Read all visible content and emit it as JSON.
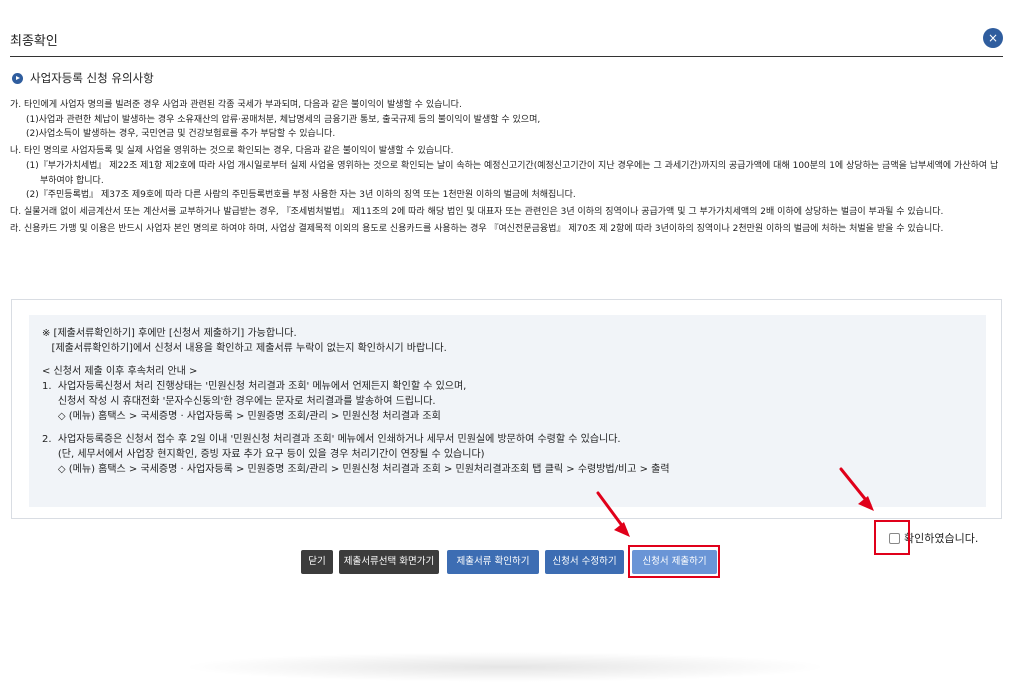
{
  "header": {
    "title": "최종확인",
    "close_label": "×"
  },
  "section": {
    "title": "사업자등록 신청 유의사항"
  },
  "notice": {
    "ga": "가. 타인에게 사업자 명의를 빌려준 경우 사업과 관련된 각종 국세가 부과되며, 다음과 같은 불이익이 발생할 수 있습니다.",
    "ga1": "(1)사업과 관련한 체납이 발생하는 경우 소유재산의 압류·공매처분, 체납명세의 금융기관 통보, 출국규제 등의 불이익이 발생할 수 있으며,",
    "ga2": "(2)사업소득이 발생하는 경우, 국민연금 및 건강보험료를 추가 부담할 수 있습니다.",
    "na": "나. 타인 명의로 사업자등록 및 실제 사업을 영위하는 것으로 확인되는 경우, 다음과 같은 불이익이 발생할 수 있습니다.",
    "na1": "(1)『부가가치세법』 제22조 제1항 제2호에 따라 사업 개시일로부터 실제 사업을 영위하는 것으로 확인되는 날이 속하는 예정신고기간(예정신고기간이 지난 경우에는 그 과세기간)까지의 공급가액에 대해 100분의 1에 상당하는 금액을 납부세액에 가산하여 납부하여야 합니다.",
    "na2": "(2)『주민등록법』 제37조 제9호에 따라 다른 사람의 주민등록번호를 부정 사용한 자는 3년 이하의 징역 또는 1천만원 이하의 벌금에 처해집니다.",
    "da": "다. 실물거래 없이 세금계산서 또는 계산서를 교부하거나 발급받는 경우, 『조세범처벌법』 제11조의 2에 따라 해당 법인 및 대표자 또는 관련인은 3년 이하의 징역이나 공급가액 및 그 부가가치세액의 2배 이하에 상당하는 벌금이 부과될 수 있습니다.",
    "ra": "라. 신용카드 가맹 및 이용은 반드시 사업자 본인 명의로 하여야 하며, 사업상 결제목적 이외의 용도로 신용카드를 사용하는 경우 『여신전문금융법』 제70조 제 2항에 따라 3년이하의 징역이나 2천만원 이하의 벌금에 처하는 처벌을 받을 수 있습니다."
  },
  "info": {
    "l1": "※ [제출서류확인하기] 후에만 [신청서 제출하기] 가능합니다.",
    "l2": "   [제출서류확인하기]에서 신청서 내용을 확인하고 제출서류 누락이 없는지 확인하시기 바랍니다.",
    "l3": "< 신청서 제출 이후 후속처리 안내 >",
    "l4": "1.  사업자등록신청서 처리 진행상태는 '민원신청 처리결과 조회' 메뉴에서 언제든지 확인할 수 있으며,",
    "l5": "     신청서 작성 시 휴대전화 '문자수신동의'한 경우에는 문자로 처리결과를 발송하여 드립니다.",
    "l6": "     ◇ (메뉴) 홈택스 > 국세증명 · 사업자등록 > 민원증명 조회/관리 > 민원신청 처리결과 조회",
    "l7": "2.  사업자등록증은 신청서 접수 후 2일 이내 '민원신청 처리결과 조회' 메뉴에서 인쇄하거나 세무서 민원실에 방문하여 수령할 수 있습니다.",
    "l8": "     (단, 세무서에서 사업장 현지확인, 증빙 자료 추가 요구 등이 있을 경우 처리기간이 연장될 수 있습니다)",
    "l9": "     ◇ (메뉴) 홈택스 > 국세증명 · 사업자등록 > 민원증명 조회/관리 > 민원신청 처리결과 조회 > 민원처리결과조회 탭 클릭 > 수령방법/비고 > 출력"
  },
  "buttons": {
    "close": "닫기",
    "doc_select": "제출서류선택 화면가기",
    "doc_check": "제출서류 확인하기",
    "edit": "신청서 수정하기",
    "submit": "신청서 제출하기"
  },
  "confirm": {
    "label": "확인하였습니다."
  },
  "colors": {
    "accent": "#2f5d9e",
    "highlight": "#e0001a"
  }
}
